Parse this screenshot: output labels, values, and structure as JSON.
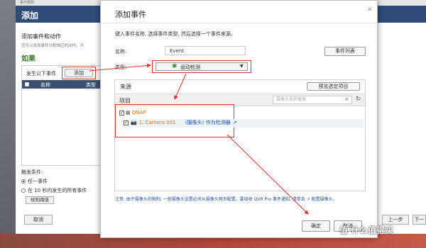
{
  "background_window": {
    "topbar_text": "事件规则",
    "title": "添加",
    "section_title": "添加事件和动作",
    "section_desc": "您可以添加事件分配相应的动作。不",
    "if_label": "如果",
    "occurred_label": "发生以下事件",
    "add_button": "添加",
    "table_headers": {
      "name": "名称",
      "type": "类型"
    },
    "trigger_label": "触发条件:",
    "radio_any": "任一事件",
    "radio_within": "在 10 秒内发生的所有事件",
    "rules_button": "规则阈值",
    "cancel_button": "取消",
    "prev_button": "上一步",
    "next_button": "下一步"
  },
  "dialog": {
    "title": "添加事件",
    "close_glyph": "✕",
    "instruction": "键入事件名称, 选择事件类型, 然后选择一个事件来源。",
    "name_label": "名称:",
    "name_value": "Event",
    "event_list_button": "事件列表",
    "type_label": "类型:",
    "type_value": "运动检测",
    "source": {
      "label": "来源",
      "preview_button": "预览选定项目",
      "items_label": "项目",
      "search_placeholder": "摄像头名称搜索",
      "tree": {
        "server_name": "QNAP",
        "camera_name": "1. Camera 001",
        "camera_link": "(摄像头)",
        "camera_suffix": "作为检测器"
      }
    },
    "note": "注意: 由于摄像头的限制, 一些摄像头设置必须从摄像头网页配置。要接收 QVR Pro 事件通知, 请单击 ↗ 配置摄像头。",
    "ok_button": "确定",
    "cancel_button": "取消"
  },
  "watermark": "值 什么值得买",
  "icons": {
    "motion": "motion-detect-icon",
    "search": "search-icon",
    "refresh": "refresh-icon",
    "server": "server-icon",
    "camera": "camera-icon",
    "external": "external-link-icon"
  },
  "colors": {
    "header": "#2f4b77",
    "highlight": "#e03030",
    "link": "#1a4fb5",
    "orange": "#e07020"
  }
}
